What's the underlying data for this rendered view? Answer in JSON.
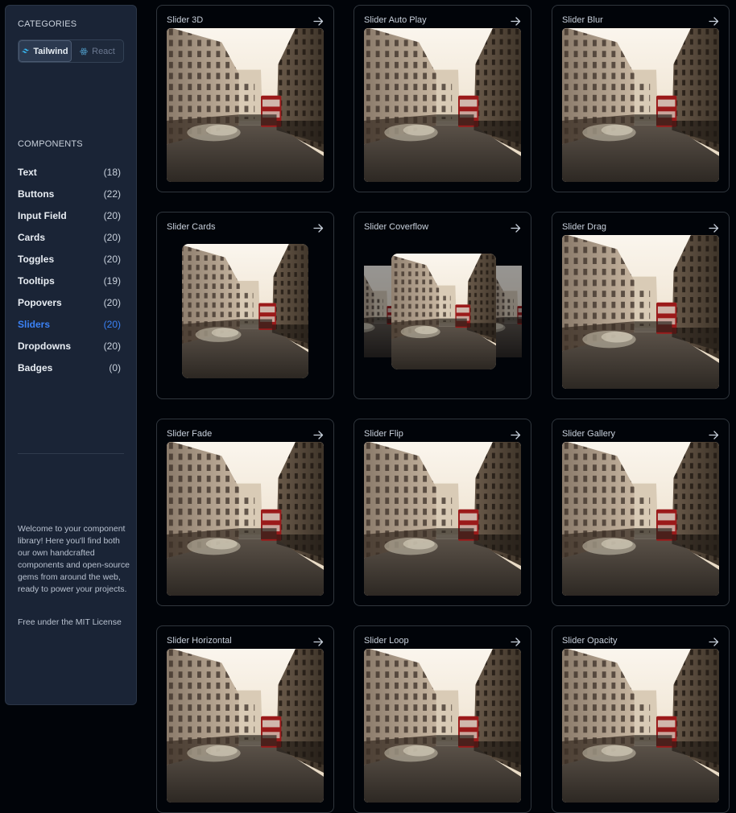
{
  "sidebar": {
    "categories_title": "CATEGORIES",
    "toggle": [
      {
        "label": "Tailwind",
        "active": true,
        "icon": "tailwind-icon"
      },
      {
        "label": "React",
        "active": false,
        "icon": "react-icon"
      }
    ],
    "components_title": "COMPONENTS",
    "components": [
      {
        "label": "Text",
        "count": "(18)"
      },
      {
        "label": "Buttons",
        "count": "(22)"
      },
      {
        "label": "Input Field",
        "count": "(20)"
      },
      {
        "label": "Cards",
        "count": "(20)"
      },
      {
        "label": "Toggles",
        "count": "(20)"
      },
      {
        "label": "Tooltips",
        "count": "(19)"
      },
      {
        "label": "Popovers",
        "count": "(20)"
      },
      {
        "label": "Sliders",
        "count": "(20)",
        "active": true
      },
      {
        "label": "Dropdowns",
        "count": "(20)"
      },
      {
        "label": "Badges",
        "count": "(0)"
      }
    ],
    "welcome": "Welcome to your component library! Here you'll find both our own handcrafted components and open-source gems from around the web, ready to power your projects.",
    "license": "Free under the MIT License"
  },
  "cards": [
    {
      "title": "Slider 3D",
      "variant": "full"
    },
    {
      "title": "Slider Auto Play",
      "variant": "full"
    },
    {
      "title": "Slider Blur",
      "variant": "full"
    },
    {
      "title": "Slider Cards",
      "variant": "cards"
    },
    {
      "title": "Slider Coverflow",
      "variant": "coverflow"
    },
    {
      "title": "Slider Drag",
      "variant": "full"
    },
    {
      "title": "Slider Fade",
      "variant": "full"
    },
    {
      "title": "Slider Flip",
      "variant": "full"
    },
    {
      "title": "Slider Gallery",
      "variant": "full"
    },
    {
      "title": "Slider Horizontal",
      "variant": "full"
    },
    {
      "title": "Slider Loop",
      "variant": "full"
    },
    {
      "title": "Slider Opacity",
      "variant": "full"
    }
  ],
  "colors": {
    "accent": "#3b82f6",
    "sidebar_bg": "#1a2436",
    "page_bg": "#010409"
  }
}
